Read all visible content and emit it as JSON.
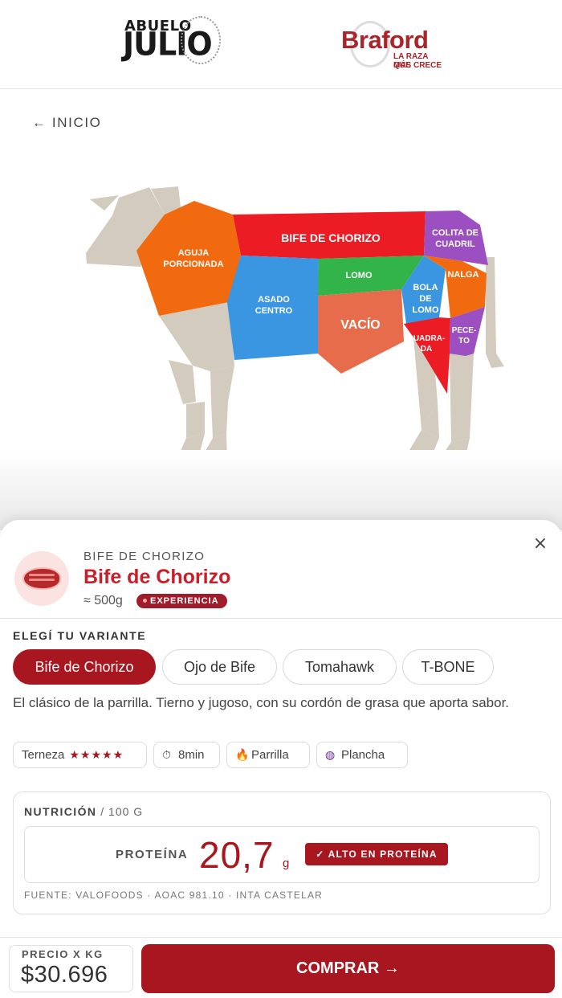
{
  "header": {
    "logo_abuelo_line1": "ABUELO",
    "logo_abuelo_line2": "JULIO",
    "logo_abuelo_ring": "CARNE ARGENTINA",
    "logo_braford_name": "Braford",
    "logo_braford_tag1": "LA RAZA QUE",
    "logo_braford_tag2": "MÁS CRECE"
  },
  "nav": {
    "back_label": "← INICIO"
  },
  "cow_map": {
    "cuts": [
      {
        "key": "aguja",
        "label_lines": [
          "AGUJA",
          "PORCIONADA"
        ],
        "color": "#f26a0f"
      },
      {
        "key": "bife",
        "label_lines": [
          "BIFE DE CHORIZO"
        ],
        "color": "#ec1c24"
      },
      {
        "key": "colita",
        "label_lines": [
          "COLITA DE",
          "CUADRIL"
        ],
        "color": "#9b4fc0"
      },
      {
        "key": "asado",
        "label_lines": [
          "ASADO",
          "CENTRO"
        ],
        "color": "#3a96e0"
      },
      {
        "key": "lomo",
        "label_lines": [
          "LOMO"
        ],
        "color": "#33b44a"
      },
      {
        "key": "vacio",
        "label_lines": [
          "VACÍO"
        ],
        "color": "#e66c4b"
      },
      {
        "key": "bola",
        "label_lines": [
          "BOLA",
          "DE",
          "LOMO"
        ],
        "color": "#3a96e0"
      },
      {
        "key": "nalga",
        "label_lines": [
          "NALGA"
        ],
        "color": "#f26a0f"
      },
      {
        "key": "cuadrada",
        "label_lines": [
          "CUADRA-",
          "DA"
        ],
        "color": "#ec1c24"
      },
      {
        "key": "peceto",
        "label_lines": [
          "PECE-",
          "TO"
        ],
        "color": "#9b4fc0"
      }
    ],
    "body_color": "#d4cbbf"
  },
  "sheet": {
    "close_label": "×",
    "eyebrow": "BIFE DE CHORIZO",
    "title": "Bife de Chorizo",
    "weight": "≈ 500g",
    "badge": "EXPERIENCIA",
    "variant_heading": "ELEGÍ TU VARIANTE",
    "variants": [
      "Bife de Chorizo",
      "Ojo de Bife",
      "Tomahawk",
      "T-BONE"
    ],
    "selected_variant": "Bife de Chorizo",
    "description": "El clásico de la parrilla. Tierno y jugoso, con su cordón de grasa que aporta sabor.",
    "tags": {
      "terneza_label": "Terneza",
      "terneza_stars": "★★★★★",
      "terneza_rating": 5,
      "time": "8min",
      "method1": "Parrilla",
      "method2": "Plancha"
    },
    "nutrition": {
      "title": "NUTRICIÓN",
      "per": " / 100 G",
      "protein_label": "PROTEÍNA",
      "protein_value": "20,7",
      "protein_unit": "g",
      "protein_badge": "✓ ALTO EN PROTEÍNA",
      "source": "FUENTE: VALOFOODS · AOAC 981.10 · INTA CASTELAR"
    }
  },
  "footer": {
    "price_label": "PRECIO X KG",
    "price_value": "$30.696",
    "buy_label": "COMPRAR →"
  },
  "colors": {
    "accent": "#a8161f",
    "title_red": "#c8202a"
  }
}
